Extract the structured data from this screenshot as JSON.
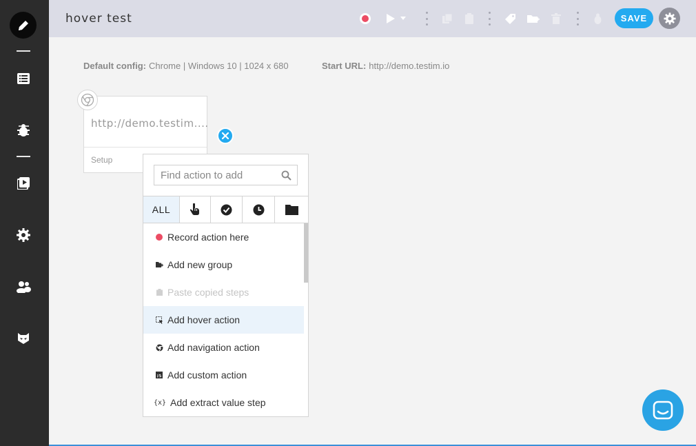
{
  "topbar": {
    "title": "hover test",
    "save_label": "SAVE"
  },
  "config": {
    "default_label": "Default config:",
    "default_value": "Chrome | Windows 10 | 1024 x 680",
    "start_label": "Start URL:",
    "start_value": "http://demo.testim.io"
  },
  "step": {
    "url": "http://demo.testim....",
    "setup_label": "Setup"
  },
  "popup": {
    "search_placeholder": "Find action to add",
    "tabs": [
      {
        "label": "ALL",
        "icon": "all"
      },
      {
        "label": "",
        "icon": "hand-pointer-icon"
      },
      {
        "label": "",
        "icon": "check-circle-icon"
      },
      {
        "label": "",
        "icon": "clock-icon"
      },
      {
        "label": "",
        "icon": "folder-icon"
      }
    ],
    "items": [
      {
        "label": "Record action here",
        "icon": "record-dot-icon"
      },
      {
        "label": "Add new group",
        "icon": "group-icon"
      },
      {
        "label": "Paste copied steps",
        "icon": "clipboard-icon"
      },
      {
        "label": "Add hover action",
        "icon": "hover-icon"
      },
      {
        "label": "Add navigation action",
        "icon": "navigation-icon"
      },
      {
        "label": "Add custom action",
        "icon": "js-icon"
      },
      {
        "label": "Add extract value step",
        "icon": "variable-icon",
        "icon_text": "{x}"
      }
    ]
  },
  "colors": {
    "accent": "#23aaf0",
    "sidebar": "#2c2c2c",
    "topbar": "#dbdce6",
    "record": "#ec4c64"
  }
}
